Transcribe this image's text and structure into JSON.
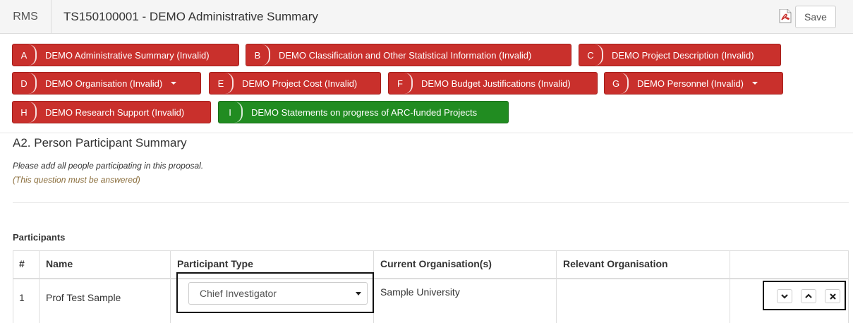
{
  "header": {
    "app_name": "RMS",
    "title": "TS150100001 - DEMO Administrative Summary",
    "save_label": "Save",
    "pdf_icon": "pdf-icon"
  },
  "sections": [
    {
      "letter": "A",
      "label": "DEMO Administrative Summary (Invalid)",
      "status": "invalid",
      "dropdown": false
    },
    {
      "letter": "B",
      "label": "DEMO Classification and Other Statistical Information (Invalid)",
      "status": "invalid",
      "dropdown": false
    },
    {
      "letter": "C",
      "label": "DEMO Project Description (Invalid)",
      "status": "invalid",
      "dropdown": false
    },
    {
      "letter": "D",
      "label": "DEMO Organisation (Invalid)",
      "status": "invalid",
      "dropdown": true
    },
    {
      "letter": "E",
      "label": "DEMO Project Cost (Invalid)",
      "status": "invalid",
      "dropdown": false
    },
    {
      "letter": "F",
      "label": "DEMO Budget Justifications (Invalid)",
      "status": "invalid",
      "dropdown": false
    },
    {
      "letter": "G",
      "label": "DEMO Personnel (Invalid)",
      "status": "invalid",
      "dropdown": true
    },
    {
      "letter": "H",
      "label": "DEMO Research Support (Invalid)",
      "status": "invalid",
      "dropdown": false
    },
    {
      "letter": "I",
      "label": "DEMO Statements on progress of ARC-funded Projects",
      "status": "valid",
      "dropdown": false
    }
  ],
  "question": {
    "title": "A2. Person Participant Summary",
    "instruction": "Please add all people participating in this proposal.",
    "required_note": "(This question must be answered)"
  },
  "participants": {
    "label": "Participants",
    "columns": [
      "#",
      "Name",
      "Participant Type",
      "Current Organisation(s)",
      "Relevant Organisation",
      ""
    ],
    "rows": [
      {
        "num": "1",
        "name": "Prof Test Sample",
        "type": "Chief Investigator",
        "current_org": "Sample University",
        "relevant_org": ""
      }
    ]
  },
  "colors": {
    "invalid": "#c9302c",
    "valid": "#218c21",
    "required_note": "#8a6d3b"
  }
}
